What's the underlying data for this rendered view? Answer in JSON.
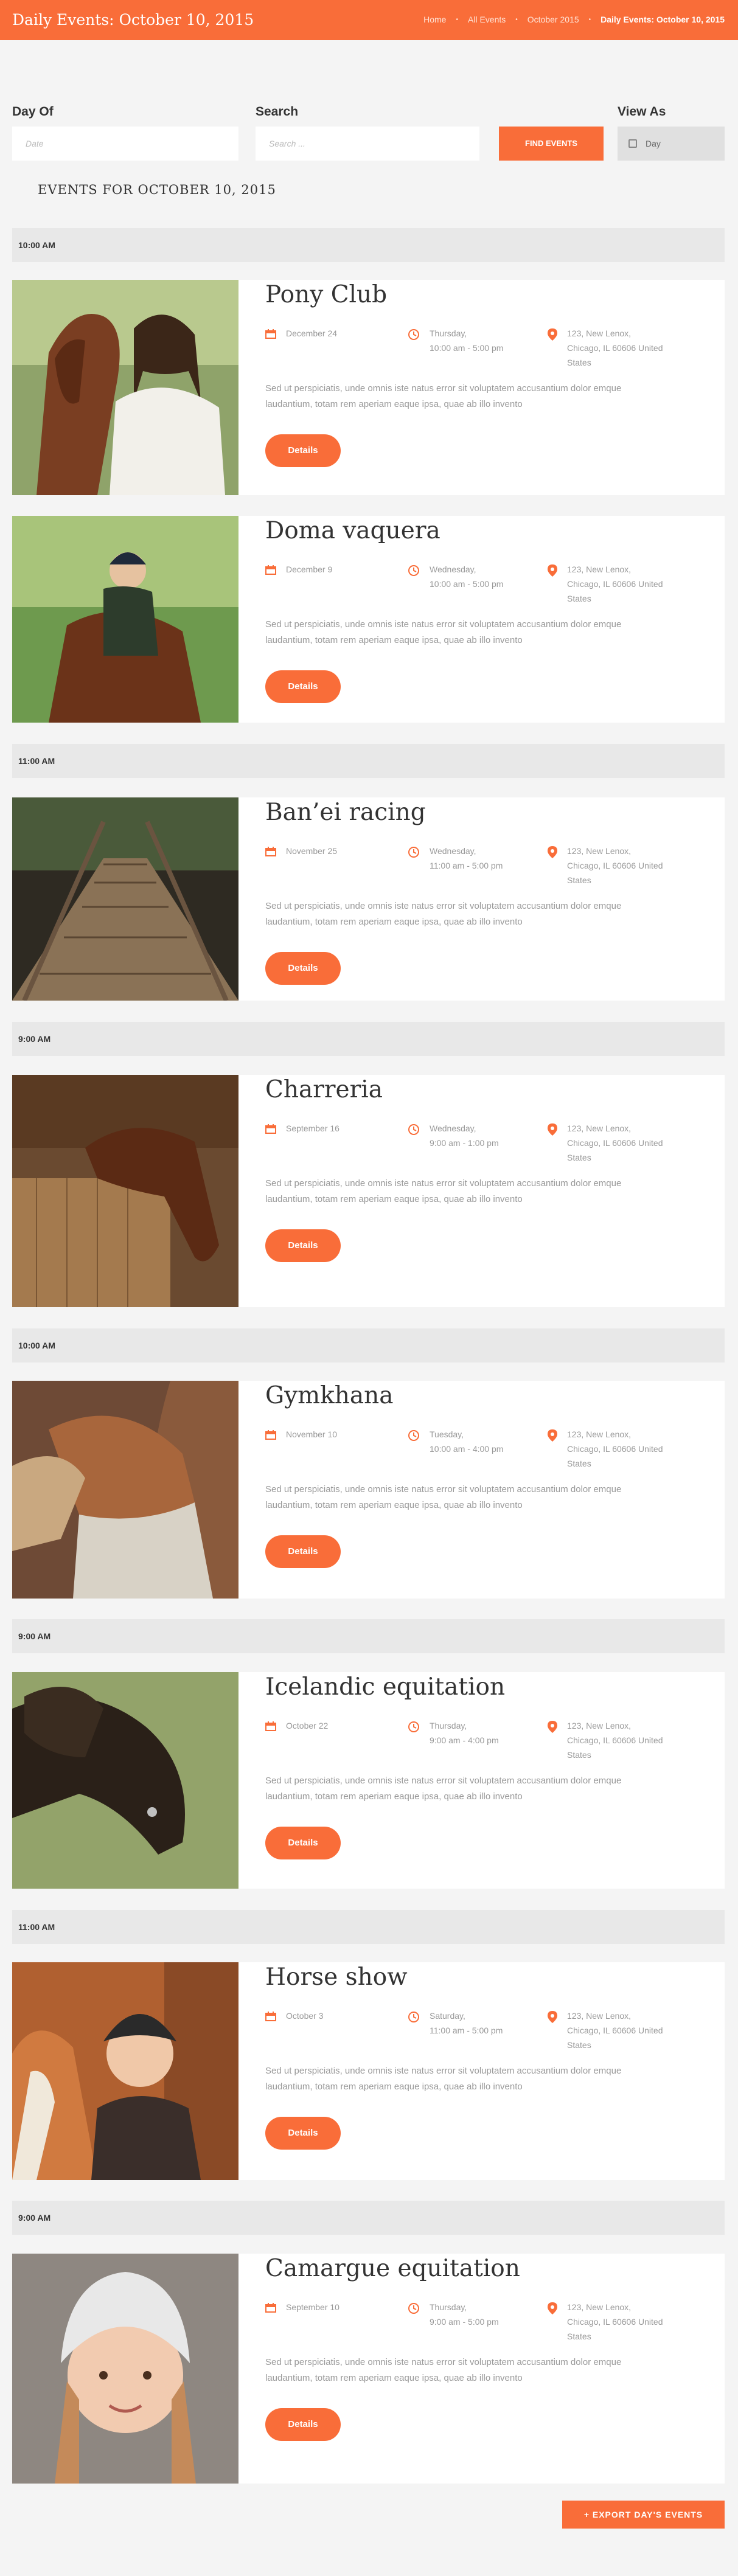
{
  "header": {
    "title": "Daily Events: October 10, 2015",
    "breadcrumbs": [
      "Home",
      "All Events",
      "October 2015",
      "Daily Events: October 10, 2015"
    ]
  },
  "filters": {
    "day_label": "Day Of",
    "day_placeholder": "Date",
    "search_label": "Search",
    "search_placeholder": "Search ...",
    "find_button": "FIND EVENTS",
    "view_label": "View As",
    "view_value": "Day"
  },
  "events_heading": "EVENTS FOR OCTOBER 10, 2015",
  "details_label": "Details",
  "description": "Sed ut perspiciatis, unde omnis iste natus error sit voluptatem accusantium dolor emque laudantium, totam rem aperiam eaque ipsa, quae ab illo invento",
  "address": [
    "123, New Lenox,",
    "Chicago, IL 60606 United",
    "States"
  ],
  "events": [
    {
      "time": "10:00 AM",
      "title": "Pony Club",
      "date": "December 24",
      "weekday": "Thursday,",
      "hours": "10:00 am - 5:00 pm"
    },
    {
      "time": "",
      "title": "Doma vaquera",
      "date": "December 9",
      "weekday": "Wednesday,",
      "hours": "10:00 am - 5:00 pm"
    },
    {
      "time": "11:00 AM",
      "title": "Ban’ei racing",
      "date": "November 25",
      "weekday": "Wednesday,",
      "hours": "11:00 am - 5:00 pm"
    },
    {
      "time": "9:00 AM",
      "title": "Charreria",
      "date": "September 16",
      "weekday": "Wednesday,",
      "hours": "9:00 am - 1:00 pm"
    },
    {
      "time": "10:00 AM",
      "title": "Gymkhana",
      "date": "November 10",
      "weekday": "Tuesday,",
      "hours": "10:00 am - 4:00 pm"
    },
    {
      "time": "9:00 AM",
      "title": "Icelandic equitation",
      "date": "October 22",
      "weekday": "Thursday,",
      "hours": "9:00 am - 4:00 pm"
    },
    {
      "time": "11:00 AM",
      "title": "Horse show",
      "date": "October 3",
      "weekday": "Saturday,",
      "hours": "11:00 am - 5:00 pm"
    },
    {
      "time": "9:00 AM",
      "title": "Camargue equitation",
      "date": "September 10",
      "weekday": "Thursday,",
      "hours": "9:00 am - 5:00 pm"
    }
  ],
  "export_button": "+ EXPORT DAY'S EVENTS",
  "colors": {
    "accent": "#f96d39",
    "page_bg": "#f4f4f4",
    "time_bar": "#e8e8e8"
  },
  "icons": [
    "calendar-icon",
    "clock-icon",
    "location-pin-icon",
    "grid-icon"
  ]
}
